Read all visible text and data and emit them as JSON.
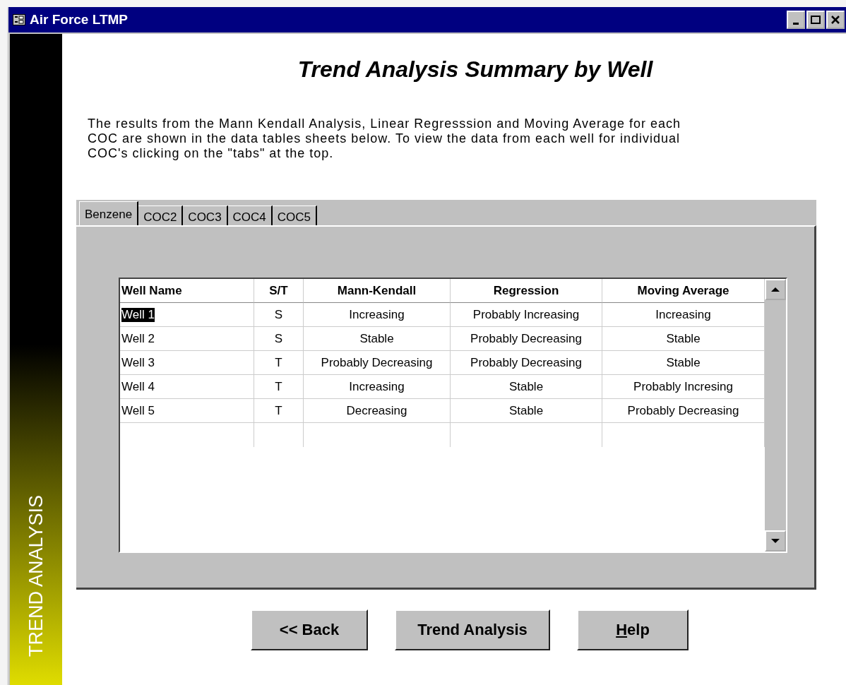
{
  "window": {
    "title": "Air Force LTMP"
  },
  "sidebar": {
    "label": "TREND ANALYSIS"
  },
  "heading": "Trend Analysis Summary by Well",
  "description": "The results from the Mann Kendall Analysis, Linear Regresssion and Moving Average for each COC are shown in the data tables sheets below. To view the data from each well for individual COC's clicking on the \"tabs\" at the top.",
  "tabs": [
    {
      "label": "Benzene",
      "selected": true
    },
    {
      "label": "COC2",
      "selected": false
    },
    {
      "label": "COC3",
      "selected": false
    },
    {
      "label": "COC4",
      "selected": false
    },
    {
      "label": "COC5",
      "selected": false
    }
  ],
  "table": {
    "columns": [
      "Well Name",
      "S/T",
      "Mann-Kendall",
      "Regression",
      "Moving Average"
    ],
    "rows": [
      {
        "cells": [
          "Well 1",
          "S",
          "Increasing",
          "Probably Increasing",
          "Increasing"
        ],
        "selected": true
      },
      {
        "cells": [
          "Well 2",
          "S",
          "Stable",
          "Probably Decreasing",
          "Stable"
        ],
        "selected": false
      },
      {
        "cells": [
          "Well 3",
          "T",
          "Probably Decreasing",
          "Probably Decreasing",
          "Stable"
        ],
        "selected": false
      },
      {
        "cells": [
          "Well 4",
          "T",
          "Increasing",
          "Stable",
          "Probably Incresing"
        ],
        "selected": false
      },
      {
        "cells": [
          "Well 5",
          "T",
          "Decreasing",
          "Stable",
          "Probably Decreasing"
        ],
        "selected": false
      }
    ]
  },
  "buttons": [
    {
      "label": "<< Back",
      "mnemonic_underlined": false
    },
    {
      "label": "Trend Analysis",
      "mnemonic_underlined": false
    },
    {
      "label": "Help",
      "mnemonic_underlined": true
    }
  ]
}
